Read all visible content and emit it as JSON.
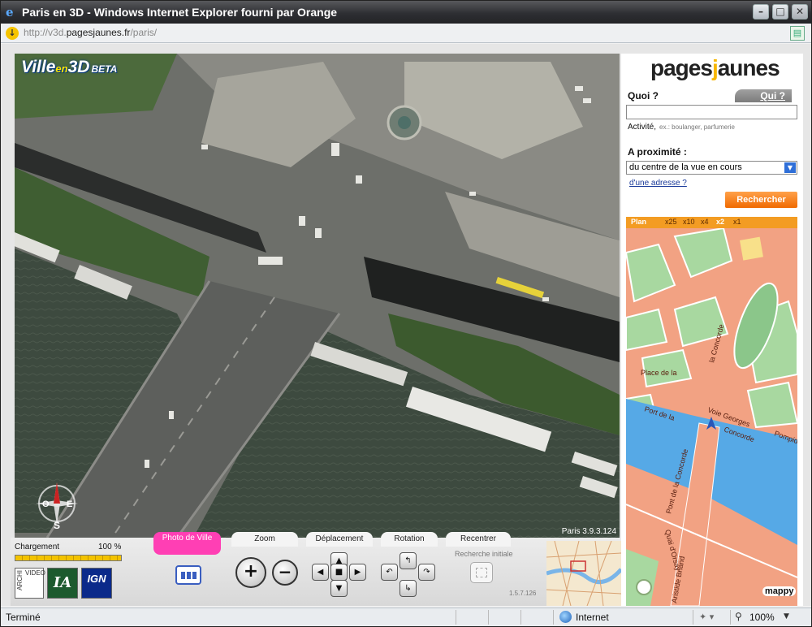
{
  "window": {
    "title": "Paris en 3D - Windows Internet Explorer fourni par Orange",
    "url_prefix": "http://v3d.",
    "url_domain": "pagesjaunes.fr",
    "url_suffix": "/paris/"
  },
  "view3d": {
    "logo_main": "Ville",
    "logo_en": "en",
    "logo_3d": "3D",
    "logo_beta": "BETA",
    "version": "Paris 3.9.3.124",
    "compass": {
      "west": "O",
      "east": "E",
      "south": "S"
    }
  },
  "controls": {
    "loading_label": "Chargement",
    "loading_percent": "100 %",
    "loading_fraction": 1.0,
    "partners": [
      "ARCHI",
      "VIDEO",
      "IA",
      "IGN"
    ],
    "photo_tab": "Photo de Ville",
    "tabs": [
      "Zoom",
      "Déplacement",
      "Rotation",
      "Recentrer"
    ],
    "zoom_in": "+",
    "zoom_out": "−",
    "reset_label": "Recherche initiale",
    "app_version": "1.5.7.126"
  },
  "panel": {
    "logo_left": "pages",
    "logo_j": "j",
    "logo_right": "aunes",
    "quoi_label": "Quoi ?",
    "qui_tab": "Qui ?",
    "quoi_value": "",
    "activity_label": "Activité,",
    "activity_example": "ex.: boulanger, parfumerie",
    "proximity_label": "A proximité :",
    "proximity_value": "du centre de la vue en cours",
    "address_link": "d'une adresse ?",
    "search_button": "Rechercher",
    "map_plan": "Plan",
    "map_zooms": [
      "x25",
      "x10",
      "x4",
      "x2",
      "x1"
    ],
    "map_active_zoom": "x2",
    "map_labels": [
      "Place de la",
      "la Concorde",
      "Port de la",
      "Voie Georges",
      "Concorde",
      "Pompidou",
      "Pont de la Concorde",
      "Quai d'Orsay",
      "Aristide Briand"
    ],
    "mappy": "mappy"
  },
  "statusbar": {
    "status": "Terminé",
    "zone": "Internet",
    "zoom": "100%"
  }
}
